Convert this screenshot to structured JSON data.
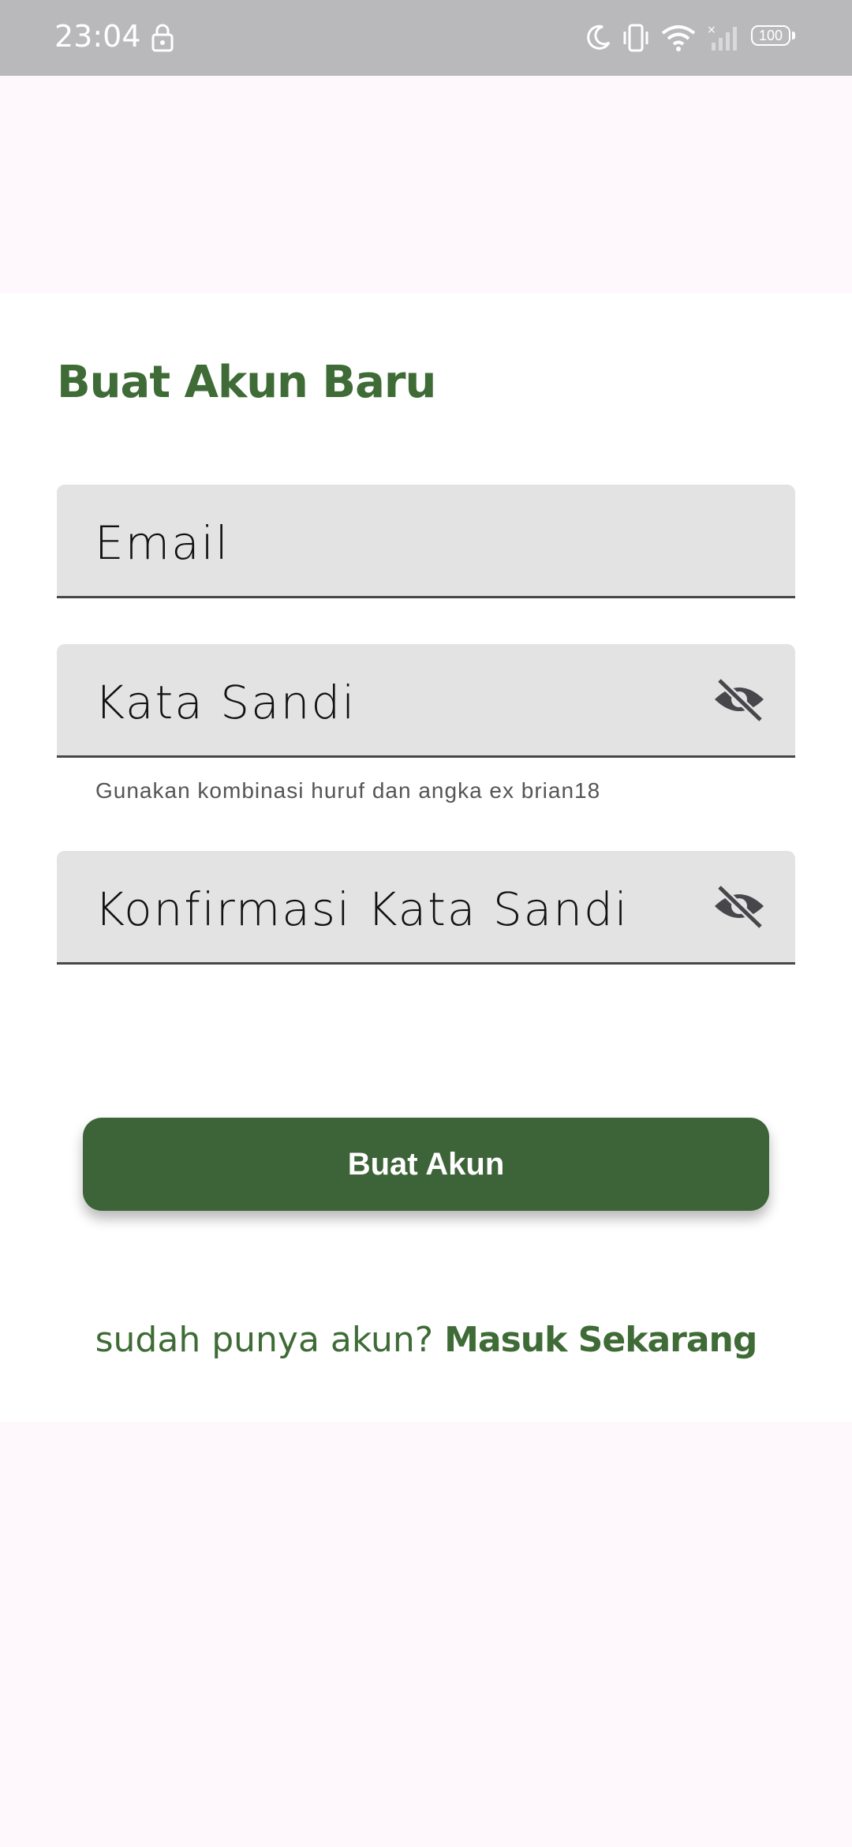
{
  "status_bar": {
    "time": "23:04",
    "battery": "100",
    "icons": [
      "lock-icon",
      "moon-icon",
      "vibrate-icon",
      "wifi-icon",
      "signal-icon",
      "battery-icon"
    ]
  },
  "page": {
    "title": "Buat Akun Baru"
  },
  "form": {
    "email_label": "Email",
    "password_label": "Kata Sandi",
    "password_helper": "Gunakan kombinasi huruf dan angka ex brian18",
    "confirm_label": "Konfirmasi Kata Sandi",
    "visibility_icon": "eye-off-icon"
  },
  "actions": {
    "create_button": "Buat Akun",
    "signin_prompt": "sudah punya akun?",
    "signin_link": "Masuk Sekarang"
  },
  "colors": {
    "brand_green": "#3e6b36",
    "button_green": "#3d6338",
    "status_bar": "#b9b8bb",
    "field_bg": "#e3e3e3",
    "page_bg": "#fef7fb"
  }
}
